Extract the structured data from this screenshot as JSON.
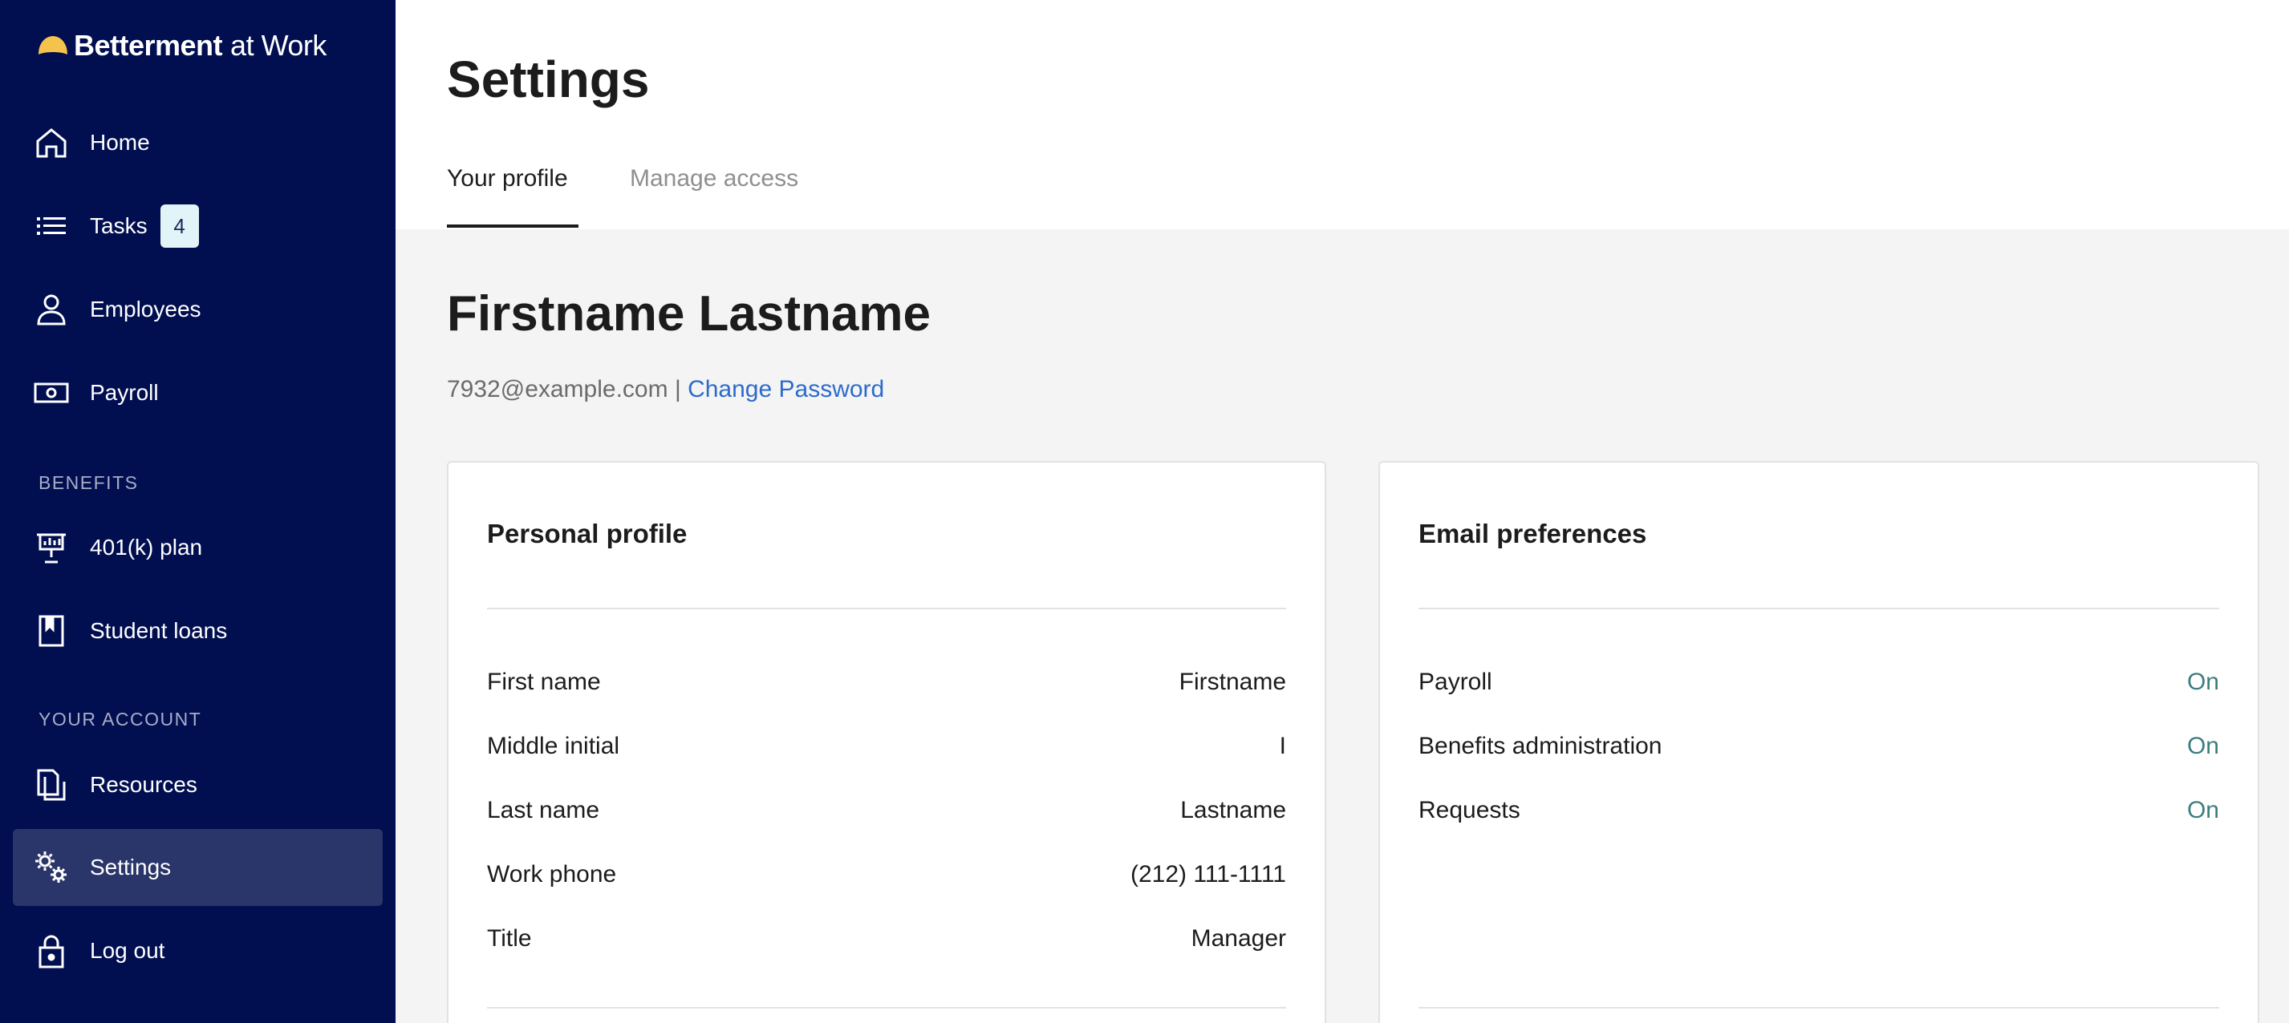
{
  "brand": {
    "name": "Betterment",
    "suffix": "at Work",
    "logo_color": "#f5c24c",
    "sidebar_color": "#010f50"
  },
  "nav": {
    "home": "Home",
    "tasks": "Tasks",
    "tasks_badge": "4",
    "employees": "Employees",
    "payroll": "Payroll",
    "benefits_label": "BENEFITS",
    "plan_401k": "401(k) plan",
    "student_loans": "Student loans",
    "account_label": "YOUR ACCOUNT",
    "resources": "Resources",
    "settings": "Settings",
    "logout": "Log out"
  },
  "header": {
    "title": "Settings",
    "tabs": [
      "Your profile",
      "Manage access"
    ]
  },
  "user": {
    "name": "Firstname Lastname",
    "email": "7932@example.com",
    "separator": " | ",
    "change_password": "Change Password"
  },
  "personal_profile": {
    "title": "Personal profile",
    "rows": [
      {
        "label": "First name",
        "value": "Firstname"
      },
      {
        "label": "Middle initial",
        "value": "I"
      },
      {
        "label": "Last name",
        "value": "Lastname"
      },
      {
        "label": "Work phone",
        "value": "(212) 111-1111"
      },
      {
        "label": "Title",
        "value": "Manager"
      }
    ]
  },
  "email_preferences": {
    "title": "Email preferences",
    "rows": [
      {
        "label": "Payroll",
        "value": "On"
      },
      {
        "label": "Benefits administration",
        "value": "On"
      },
      {
        "label": "Requests",
        "value": "On"
      }
    ]
  }
}
